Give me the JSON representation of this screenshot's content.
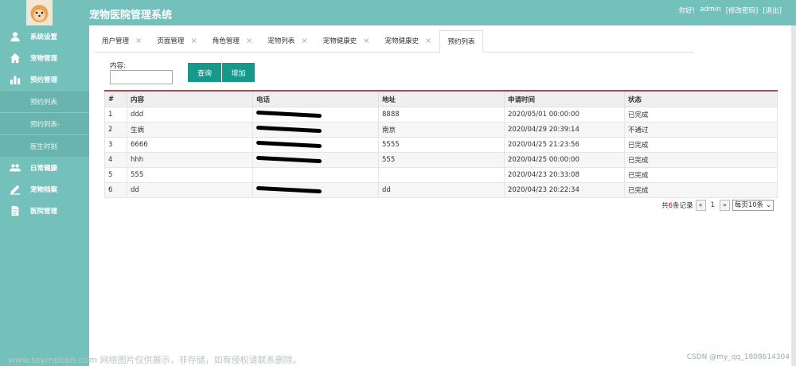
{
  "header": {
    "title": "宠物医院管理系统",
    "greeting": "你好!",
    "username": "admin",
    "change_password": "[修改密码]",
    "logout": "[退出]"
  },
  "sidebar": {
    "items": [
      {
        "label": "系统设置",
        "icon": "user-icon"
      },
      {
        "label": "宠物管理",
        "icon": "home-icon"
      },
      {
        "label": "预约管理",
        "icon": "chart-icon"
      }
    ],
    "sub_items": [
      {
        "label": "预约列表"
      },
      {
        "label": "预约列表-"
      },
      {
        "label": "医生时刻"
      }
    ],
    "items_after": [
      {
        "label": "日常健康",
        "icon": "group-icon"
      },
      {
        "label": "宠物档案",
        "icon": "edit-icon"
      },
      {
        "label": "医院管理",
        "icon": "document-icon"
      }
    ]
  },
  "tabs": [
    {
      "label": "用户管理",
      "active": false
    },
    {
      "label": "页面管理",
      "active": false
    },
    {
      "label": "角色管理",
      "active": false
    },
    {
      "label": "宠物列表",
      "active": false
    },
    {
      "label": "宠物健康史",
      "active": false
    },
    {
      "label": "宠物健康史",
      "active": false
    },
    {
      "label": "预约列表",
      "active": true
    }
  ],
  "tab_close": "×",
  "search": {
    "label": "内容:",
    "value": "",
    "query_button": "查询",
    "add_button": "增加"
  },
  "table": {
    "columns": [
      "#",
      "内容",
      "电话",
      "地址",
      "申请时间",
      "状态"
    ],
    "rows": [
      {
        "num": "1",
        "content": "ddd",
        "phone": "",
        "address": "8888",
        "time": "2020/05/01 00:00:00",
        "status": "已完成"
      },
      {
        "num": "2",
        "content": "生病",
        "phone": "",
        "address": "南京",
        "time": "2020/04/29 20:39:14",
        "status": "不通过"
      },
      {
        "num": "3",
        "content": "6666",
        "phone": "",
        "address": "5555",
        "time": "2020/04/25 21:23:56",
        "status": "已完成"
      },
      {
        "num": "4",
        "content": "hhh",
        "phone": "",
        "address": "555",
        "time": "2020/04/25 00:00:00",
        "status": "已完成"
      },
      {
        "num": "5",
        "content": "555",
        "phone": "",
        "address": "",
        "time": "2020/04/23 20:33:08",
        "status": "已完成"
      },
      {
        "num": "6",
        "content": "dd",
        "phone": "",
        "address": "dd",
        "time": "2020/04/23 20:22:34",
        "status": "已完成"
      }
    ]
  },
  "pager": {
    "total_prefix": "共",
    "total_count": "6",
    "total_suffix": "条记录",
    "prev": "«",
    "current_page": "1",
    "next": "»",
    "page_size": "每页10条"
  },
  "watermark": {
    "left": "www.toymoban.com 网络图片仅供展示，非存储，如有侵权请联系删除。",
    "right": "CSDN @my_qq_1808614304"
  },
  "colors": {
    "theme": "#74c1bb",
    "button": "#16998a",
    "table_accent": "#b04545"
  }
}
